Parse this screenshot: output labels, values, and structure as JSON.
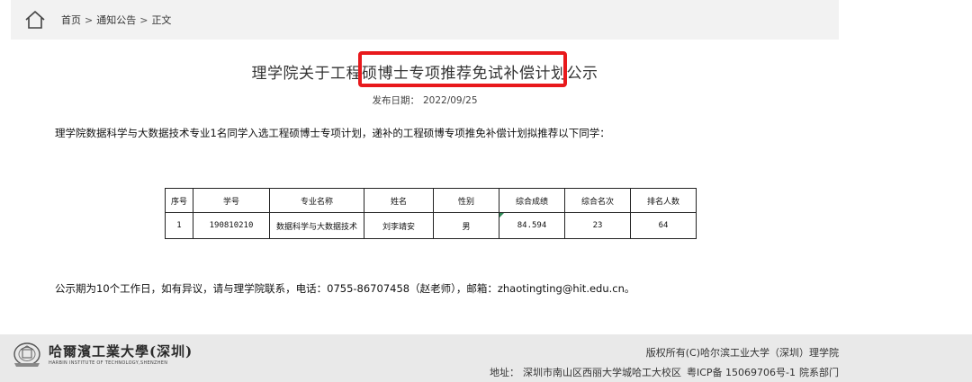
{
  "breadcrumb": {
    "items": [
      "首页",
      "通知公告",
      "正文"
    ],
    "separator": ">"
  },
  "article": {
    "title": "理学院关于工程硕博士专项推荐免试补偿计划公示",
    "publish_label": "发布日期：",
    "publish_date": "2022/09/25",
    "intro": "理学院数据科学与大数据技术专业1名同学入选工程硕博士专项计划，递补的工程硕博专项推免补偿计划拟推荐以下同学：",
    "notice": "公示期为10个工作日，如有异议，请与理学院联系，电话：0755-86707458（赵老师），邮箱：zhaotingting@hit.edu.cn。"
  },
  "table": {
    "headers": [
      "序号",
      "学号",
      "专业名称",
      "姓名",
      "性别",
      "综合成绩",
      "综合名次",
      "排名人数"
    ],
    "rows": [
      [
        "1",
        "190810210",
        "数据科学与大数据技术",
        "刘李靖安",
        "男",
        "84.594",
        "23",
        "64"
      ]
    ]
  },
  "footer": {
    "logo_cn": "哈爾濱工業大學(深圳)",
    "logo_en": "HARBIN INSTITUTE OF TECHNOLOGY,SHENZHEN",
    "copyright": "版权所有(C)哈尔滨工业大学（深圳）理学院",
    "address_label": "地址：",
    "address": "深圳市南山区西丽大学城哈工大校区",
    "icp": "粤ICP备 15069706号-1",
    "dept": "院系部门"
  },
  "colors": {
    "highlight": "#e8191c",
    "breadcrumb_bg": "#f2f2f2",
    "footer_bg": "#e9e9e9"
  },
  "icons": {
    "home": "home-icon",
    "emblem": "university-emblem-icon"
  }
}
